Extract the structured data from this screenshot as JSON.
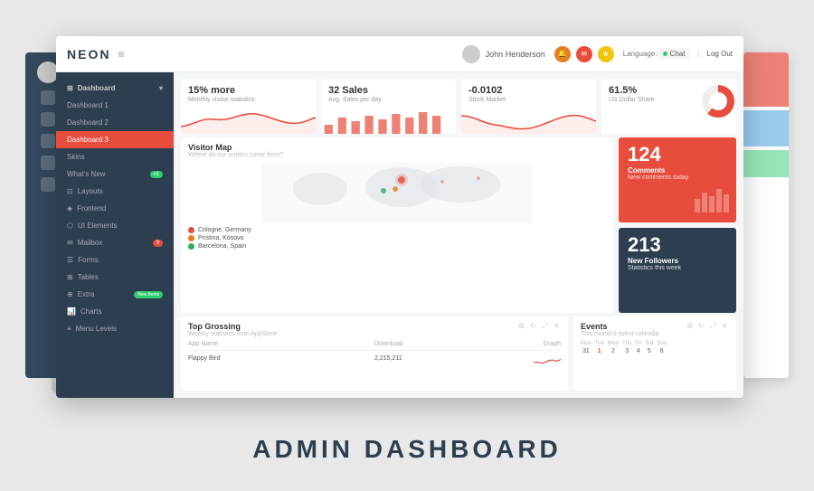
{
  "page": {
    "bottom_title": "ADMIN DASHBOARD"
  },
  "topbar": {
    "logo": "NEON",
    "user_name": "John Henderson",
    "language_label": "Language:",
    "chat_label": "Chat",
    "logout_label": "Log Out"
  },
  "sidebar": {
    "main_item": "Dashboard",
    "items": [
      {
        "label": "Dashboard 1",
        "active": false
      },
      {
        "label": "Dashboard 2",
        "active": false
      },
      {
        "label": "Dashboard 3",
        "active": true
      },
      {
        "label": "Skins",
        "active": false
      },
      {
        "label": "What's New",
        "active": false,
        "badge": "v1"
      },
      {
        "label": "Layouts",
        "active": false
      },
      {
        "label": "Frontend",
        "active": false
      },
      {
        "label": "UI Elements",
        "active": false
      },
      {
        "label": "Mailbox",
        "active": false,
        "badge": "9"
      },
      {
        "label": "Forms",
        "active": false
      },
      {
        "label": "Tables",
        "active": false
      },
      {
        "label": "Extra",
        "active": false,
        "badge": "New Items"
      },
      {
        "label": "Charts",
        "active": false
      },
      {
        "label": "Menu Levels",
        "active": false
      }
    ]
  },
  "stats": [
    {
      "value": "15% more",
      "label": "Monthly visitor statistics"
    },
    {
      "value": "32 Sales",
      "sublabel": "Avg. Sales per day"
    },
    {
      "value": "-0.0102",
      "sublabel": "Stock Market"
    },
    {
      "value": "61.5%",
      "sublabel": "US Dollar Share"
    }
  ],
  "visitor_map": {
    "title": "Visitor Map",
    "subtitle": "Where do our visitors come from?",
    "locations": [
      {
        "name": "Cologne, Germany",
        "color": "red"
      },
      {
        "name": "Pristina, Kosovo",
        "color": "orange"
      },
      {
        "name": "Barcelona, Spain",
        "color": "green"
      }
    ]
  },
  "comments_card": {
    "count": "124",
    "label": "Comments",
    "sublabel": "New comments today"
  },
  "followers_card": {
    "count": "213",
    "label": "New Followers",
    "sublabel": "Statistics this week"
  },
  "top_grossing": {
    "title": "Top Grossing",
    "subtitle": "Weekly statistics from AppStore",
    "headers": [
      "App Name",
      "Download",
      "Graph"
    ],
    "rows": [
      {
        "name": "Flappy Bird",
        "downloads": "2,215,211"
      }
    ]
  },
  "events": {
    "title": "Events",
    "subtitle": "This month's event calendar",
    "days": [
      {
        "label": "Mon",
        "num": "31",
        "highlight": false
      },
      {
        "label": "Tue",
        "num": "1",
        "highlight": true
      },
      {
        "label": "Wed",
        "num": "2",
        "highlight": false
      },
      {
        "label": "Thu",
        "num": "3",
        "highlight": false
      },
      {
        "label": "Fri",
        "num": "4",
        "highlight": false
      },
      {
        "label": "Sat",
        "num": "5",
        "highlight": false
      },
      {
        "label": "Sun",
        "num": "6",
        "highlight": false
      }
    ]
  }
}
